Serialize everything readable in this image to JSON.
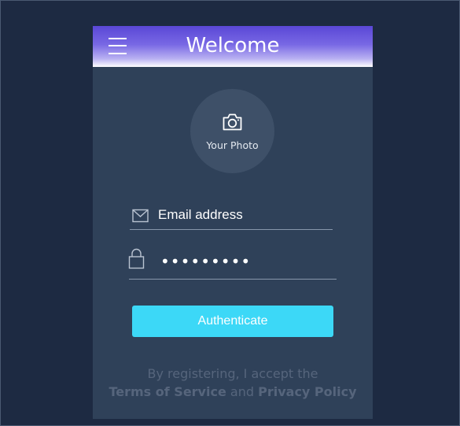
{
  "header": {
    "title": "Welcome",
    "menu_icon": "hamburger-menu-icon"
  },
  "photo": {
    "label": "Your Photo",
    "icon": "camera-icon"
  },
  "form": {
    "email_placeholder": "Email address",
    "email_icon": "mail-icon",
    "password_value": "•••••••••",
    "password_icon": "lock-icon",
    "submit_label": "Authenticate"
  },
  "terms": {
    "prefix": "By registering, I accept the",
    "terms_link": "Terms of Service",
    "conjunction": "and",
    "privacy_link": "Privacy Policy"
  },
  "colors": {
    "background": "#1d2a42",
    "card": "#2f4159",
    "header_gradient_top": "#5a47d6",
    "button": "#3cd8f7"
  }
}
